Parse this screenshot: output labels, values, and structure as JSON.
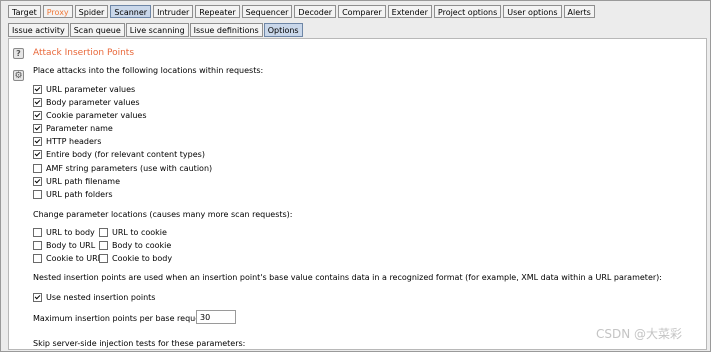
{
  "main_tabs": [
    "Target",
    "Proxy",
    "Spider",
    "Scanner",
    "Intruder",
    "Repeater",
    "Sequencer",
    "Decoder",
    "Comparer",
    "Extender",
    "Project options",
    "User options",
    "Alerts"
  ],
  "sub_tabs": [
    "Issue activity",
    "Scan queue",
    "Live scanning",
    "Issue definitions",
    "Options"
  ],
  "side": {
    "help_glyph": "?",
    "settings_glyph": "⚙"
  },
  "section": {
    "title": "Attack Insertion Points",
    "intro": "Place attacks into the following locations within requests:",
    "locations": [
      {
        "label": "URL parameter values",
        "checked": true
      },
      {
        "label": "Body parameter values",
        "checked": true
      },
      {
        "label": "Cookie parameter values",
        "checked": true
      },
      {
        "label": "Parameter name",
        "checked": true
      },
      {
        "label": "HTTP headers",
        "checked": true
      },
      {
        "label": "Entire body (for relevant content types)",
        "checked": true
      },
      {
        "label": "AMF string parameters (use with caution)",
        "checked": false
      },
      {
        "label": "URL path filename",
        "checked": true
      },
      {
        "label": "URL path folders",
        "checked": false
      }
    ],
    "change_heading": "Change parameter locations (causes many more scan requests):",
    "change_options": [
      {
        "label": "URL to body",
        "checked": false
      },
      {
        "label": "URL to cookie",
        "checked": false
      },
      {
        "label": "Body to URL",
        "checked": false
      },
      {
        "label": "Body to cookie",
        "checked": false
      },
      {
        "label": "Cookie to URL",
        "checked": false
      },
      {
        "label": "Cookie to body",
        "checked": false
      }
    ],
    "nested_desc": "Nested insertion points are used when an insertion point's base value contains data in a recognized format (for example, XML data within a URL parameter):",
    "nested_option": {
      "label": "Use nested insertion points",
      "checked": true
    },
    "max_label": "Maximum insertion points per base request:",
    "max_value": "30",
    "skip_label": "Skip server-side injection tests for these parameters:"
  },
  "watermark": "CSDN @大菜彩"
}
